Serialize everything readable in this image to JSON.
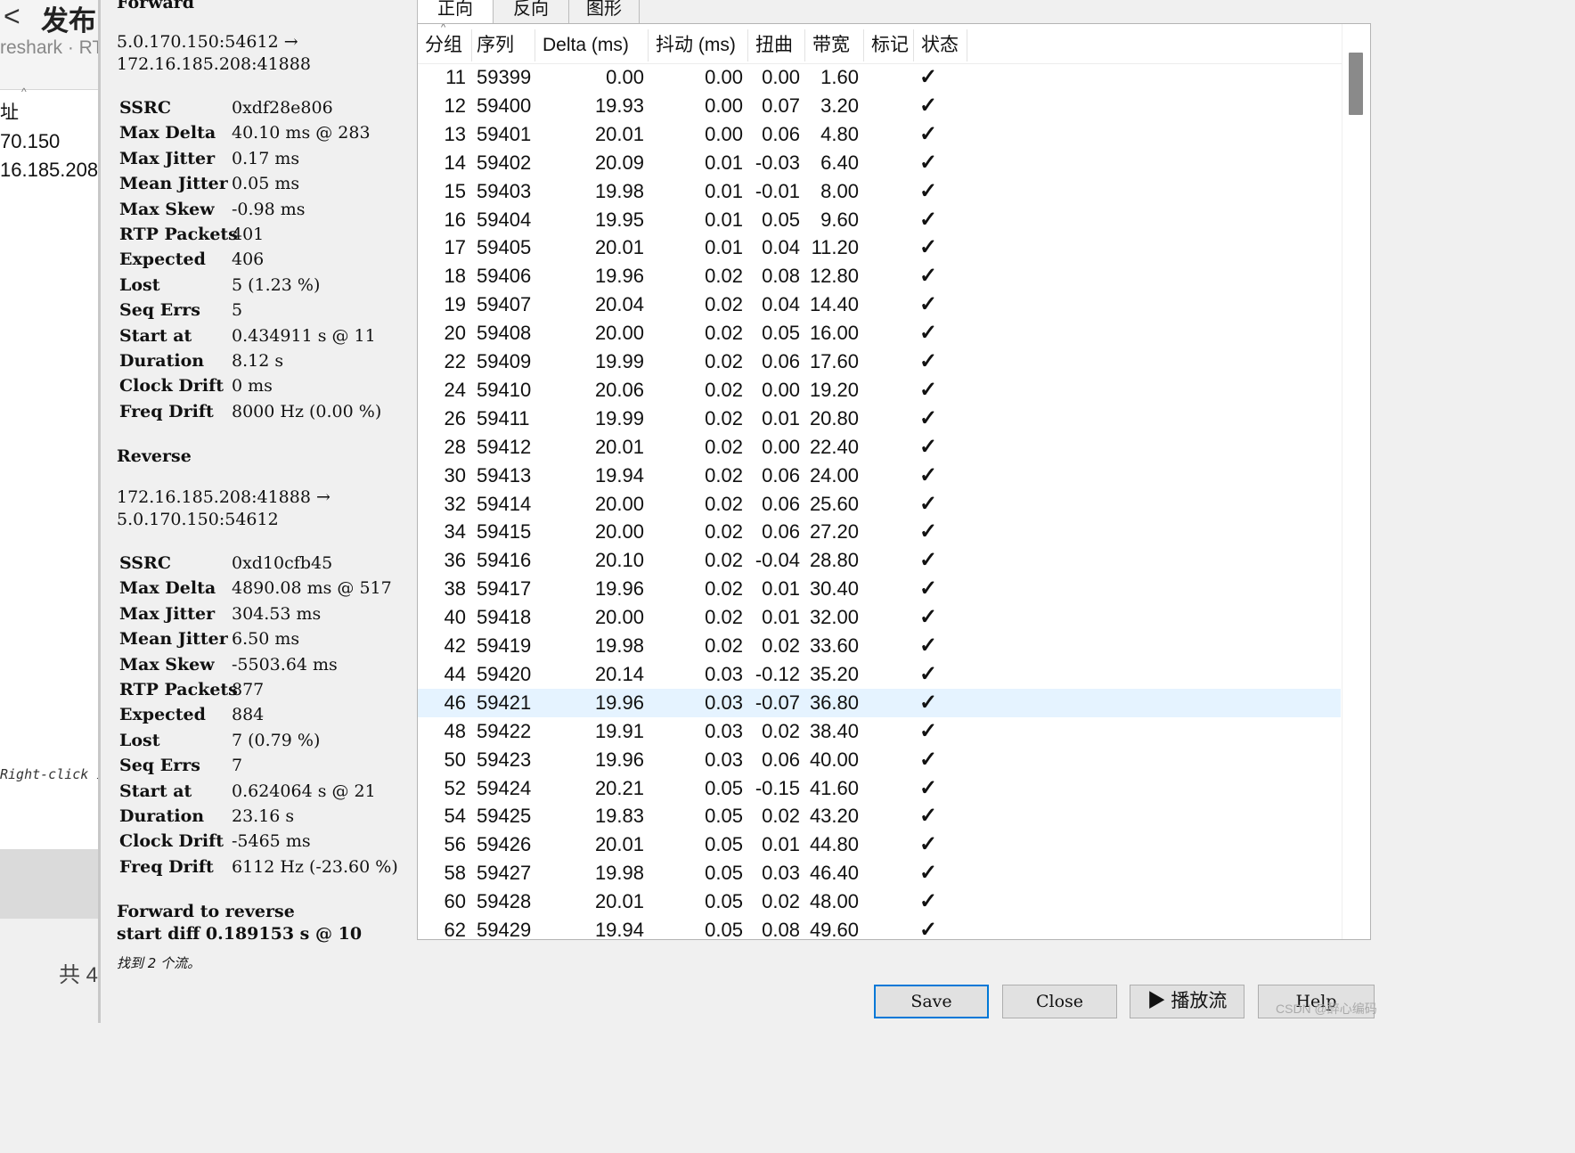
{
  "background_window": {
    "back_glyph": "<",
    "title": "发布",
    "subtitle": "reshark · RT",
    "sort_caret": "^",
    "column_header": "址",
    "rows": [
      "70.150",
      "16.185.208"
    ],
    "hint": "Right-click i",
    "footer_count": "共 4"
  },
  "stats": {
    "forward_heading": "Forward",
    "forward_addr_line1": "5.0.170.150:54612 →",
    "forward_addr_line2": "172.16.185.208:41888",
    "forward_rows": [
      {
        "key": "SSRC",
        "value": "0xdf28e806"
      },
      {
        "key": "Max Delta",
        "value": "40.10 ms @ 283"
      },
      {
        "key": "Max Jitter",
        "value": "0.17 ms"
      },
      {
        "key": "Mean Jitter",
        "value": "0.05 ms"
      },
      {
        "key": "Max Skew",
        "value": "-0.98 ms"
      },
      {
        "key": "RTP Packets",
        "value": "401"
      },
      {
        "key": "Expected",
        "value": "406"
      },
      {
        "key": "Lost",
        "value": "5 (1.23 %)"
      },
      {
        "key": "Seq Errs",
        "value": "5"
      },
      {
        "key": "Start at",
        "value": "0.434911 s @ 11"
      },
      {
        "key": "Duration",
        "value": "8.12 s"
      },
      {
        "key": "Clock Drift",
        "value": "0 ms"
      },
      {
        "key": "Freq Drift",
        "value": "8000 Hz (0.00 %)"
      }
    ],
    "reverse_heading": "Reverse",
    "reverse_addr_line1": "172.16.185.208:41888 →",
    "reverse_addr_line2": "5.0.170.150:54612",
    "reverse_rows": [
      {
        "key": "SSRC",
        "value": "0xd10cfb45"
      },
      {
        "key": "Max Delta",
        "value": "4890.08 ms @ 517"
      },
      {
        "key": "Max Jitter",
        "value": "304.53 ms"
      },
      {
        "key": "Mean Jitter",
        "value": "6.50 ms"
      },
      {
        "key": "Max Skew",
        "value": "-5503.64 ms"
      },
      {
        "key": "RTP Packets",
        "value": "877"
      },
      {
        "key": "Expected",
        "value": "884"
      },
      {
        "key": "Lost",
        "value": "7 (0.79 %)"
      },
      {
        "key": "Seq Errs",
        "value": "7"
      },
      {
        "key": "Start at",
        "value": "0.624064 s @ 21"
      },
      {
        "key": "Duration",
        "value": "23.16 s"
      },
      {
        "key": "Clock Drift",
        "value": "-5465 ms"
      },
      {
        "key": "Freq Drift",
        "value": "6112 Hz (-23.60 %)"
      }
    ],
    "compare_line1": "Forward to reverse",
    "compare_line2": "start diff 0.189153 s @ 10",
    "streams_found": "找到 2 个流。"
  },
  "tabs": [
    {
      "label": "正向",
      "active": true
    },
    {
      "label": "反向",
      "active": false
    },
    {
      "label": "图形",
      "active": false
    }
  ],
  "table": {
    "sort_caret": "^",
    "columns": [
      "分组",
      "序列",
      "Delta (ms)",
      "抖动 (ms)",
      "扭曲",
      "带宽",
      "标记",
      "状态"
    ],
    "status_glyph": "✓",
    "selected_row_index": 22,
    "rows": [
      {
        "packet": "11",
        "sequence": "59399",
        "delta": "0.00",
        "jitter": "0.00",
        "skew": "0.00",
        "bandwidth": "1.60",
        "marker": ""
      },
      {
        "packet": "12",
        "sequence": "59400",
        "delta": "19.93",
        "jitter": "0.00",
        "skew": "0.07",
        "bandwidth": "3.20",
        "marker": ""
      },
      {
        "packet": "13",
        "sequence": "59401",
        "delta": "20.01",
        "jitter": "0.00",
        "skew": "0.06",
        "bandwidth": "4.80",
        "marker": ""
      },
      {
        "packet": "14",
        "sequence": "59402",
        "delta": "20.09",
        "jitter": "0.01",
        "skew": "-0.03",
        "bandwidth": "6.40",
        "marker": ""
      },
      {
        "packet": "15",
        "sequence": "59403",
        "delta": "19.98",
        "jitter": "0.01",
        "skew": "-0.01",
        "bandwidth": "8.00",
        "marker": ""
      },
      {
        "packet": "16",
        "sequence": "59404",
        "delta": "19.95",
        "jitter": "0.01",
        "skew": "0.05",
        "bandwidth": "9.60",
        "marker": ""
      },
      {
        "packet": "17",
        "sequence": "59405",
        "delta": "20.01",
        "jitter": "0.01",
        "skew": "0.04",
        "bandwidth": "11.20",
        "marker": ""
      },
      {
        "packet": "18",
        "sequence": "59406",
        "delta": "19.96",
        "jitter": "0.02",
        "skew": "0.08",
        "bandwidth": "12.80",
        "marker": ""
      },
      {
        "packet": "19",
        "sequence": "59407",
        "delta": "20.04",
        "jitter": "0.02",
        "skew": "0.04",
        "bandwidth": "14.40",
        "marker": ""
      },
      {
        "packet": "20",
        "sequence": "59408",
        "delta": "20.00",
        "jitter": "0.02",
        "skew": "0.05",
        "bandwidth": "16.00",
        "marker": ""
      },
      {
        "packet": "22",
        "sequence": "59409",
        "delta": "19.99",
        "jitter": "0.02",
        "skew": "0.06",
        "bandwidth": "17.60",
        "marker": ""
      },
      {
        "packet": "24",
        "sequence": "59410",
        "delta": "20.06",
        "jitter": "0.02",
        "skew": "0.00",
        "bandwidth": "19.20",
        "marker": ""
      },
      {
        "packet": "26",
        "sequence": "59411",
        "delta": "19.99",
        "jitter": "0.02",
        "skew": "0.01",
        "bandwidth": "20.80",
        "marker": ""
      },
      {
        "packet": "28",
        "sequence": "59412",
        "delta": "20.01",
        "jitter": "0.02",
        "skew": "0.00",
        "bandwidth": "22.40",
        "marker": ""
      },
      {
        "packet": "30",
        "sequence": "59413",
        "delta": "19.94",
        "jitter": "0.02",
        "skew": "0.06",
        "bandwidth": "24.00",
        "marker": ""
      },
      {
        "packet": "32",
        "sequence": "59414",
        "delta": "20.00",
        "jitter": "0.02",
        "skew": "0.06",
        "bandwidth": "25.60",
        "marker": ""
      },
      {
        "packet": "34",
        "sequence": "59415",
        "delta": "20.00",
        "jitter": "0.02",
        "skew": "0.06",
        "bandwidth": "27.20",
        "marker": ""
      },
      {
        "packet": "36",
        "sequence": "59416",
        "delta": "20.10",
        "jitter": "0.02",
        "skew": "-0.04",
        "bandwidth": "28.80",
        "marker": ""
      },
      {
        "packet": "38",
        "sequence": "59417",
        "delta": "19.96",
        "jitter": "0.02",
        "skew": "0.01",
        "bandwidth": "30.40",
        "marker": ""
      },
      {
        "packet": "40",
        "sequence": "59418",
        "delta": "20.00",
        "jitter": "0.02",
        "skew": "0.01",
        "bandwidth": "32.00",
        "marker": ""
      },
      {
        "packet": "42",
        "sequence": "59419",
        "delta": "19.98",
        "jitter": "0.02",
        "skew": "0.02",
        "bandwidth": "33.60",
        "marker": ""
      },
      {
        "packet": "44",
        "sequence": "59420",
        "delta": "20.14",
        "jitter": "0.03",
        "skew": "-0.12",
        "bandwidth": "35.20",
        "marker": ""
      },
      {
        "packet": "46",
        "sequence": "59421",
        "delta": "19.96",
        "jitter": "0.03",
        "skew": "-0.07",
        "bandwidth": "36.80",
        "marker": ""
      },
      {
        "packet": "48",
        "sequence": "59422",
        "delta": "19.91",
        "jitter": "0.03",
        "skew": "0.02",
        "bandwidth": "38.40",
        "marker": ""
      },
      {
        "packet": "50",
        "sequence": "59423",
        "delta": "19.96",
        "jitter": "0.03",
        "skew": "0.06",
        "bandwidth": "40.00",
        "marker": ""
      },
      {
        "packet": "52",
        "sequence": "59424",
        "delta": "20.21",
        "jitter": "0.05",
        "skew": "-0.15",
        "bandwidth": "41.60",
        "marker": ""
      },
      {
        "packet": "54",
        "sequence": "59425",
        "delta": "19.83",
        "jitter": "0.05",
        "skew": "0.02",
        "bandwidth": "43.20",
        "marker": ""
      },
      {
        "packet": "56",
        "sequence": "59426",
        "delta": "20.01",
        "jitter": "0.05",
        "skew": "0.01",
        "bandwidth": "44.80",
        "marker": ""
      },
      {
        "packet": "58",
        "sequence": "59427",
        "delta": "19.98",
        "jitter": "0.05",
        "skew": "0.03",
        "bandwidth": "46.40",
        "marker": ""
      },
      {
        "packet": "60",
        "sequence": "59428",
        "delta": "20.01",
        "jitter": "0.05",
        "skew": "0.02",
        "bandwidth": "48.00",
        "marker": ""
      },
      {
        "packet": "62",
        "sequence": "59429",
        "delta": "19.94",
        "jitter": "0.05",
        "skew": "0.08",
        "bandwidth": "49.60",
        "marker": ""
      }
    ]
  },
  "buttons": {
    "save": "Save",
    "close": "Close",
    "play_icon": "▶",
    "play_label": "播放流",
    "help": "Help"
  },
  "watermark": "CSDN @醉心编码",
  "colors": {
    "selected_row": "#e5f3ff",
    "focus_border": "#0078d7",
    "dialog_bg": "#f0f0f0"
  }
}
